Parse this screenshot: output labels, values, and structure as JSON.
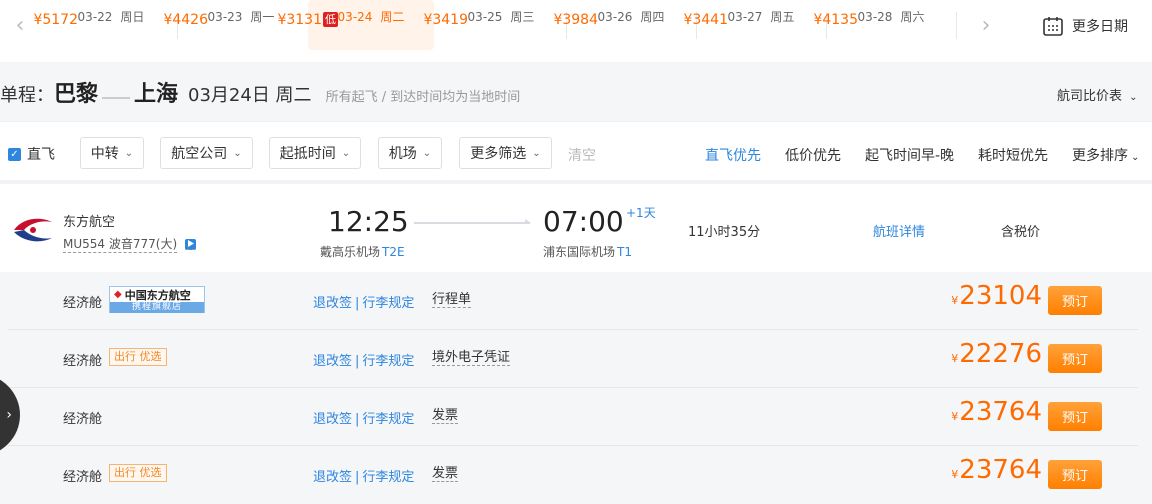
{
  "date_strip": {
    "dates": [
      {
        "date": "03-22",
        "weekday": "周日",
        "price": "¥5172"
      },
      {
        "date": "03-23",
        "weekday": "周一",
        "price": "¥4426"
      },
      {
        "date": "03-24",
        "weekday": "周二",
        "price": "¥3131",
        "badge": "低",
        "selected": true
      },
      {
        "date": "03-25",
        "weekday": "周三",
        "price": "¥3419"
      },
      {
        "date": "03-26",
        "weekday": "周四",
        "price": "¥3984"
      },
      {
        "date": "03-27",
        "weekday": "周五",
        "price": "¥3441"
      },
      {
        "date": "03-28",
        "weekday": "周六",
        "price": "¥4135"
      }
    ],
    "more_dates_label": "更多日期"
  },
  "trip": {
    "type_label": "单程：",
    "from_city": "巴黎",
    "to_city": "上海",
    "date_label": "03月24日 周二",
    "note": "所有起飞 / 到达时间均为当地时间",
    "compare_label": "航司比价表"
  },
  "filters": {
    "direct_label": "直飞",
    "direct_checked": true,
    "dropdowns": [
      "中转",
      "航空公司",
      "起抵时间",
      "机场",
      "更多筛选"
    ],
    "clear_label": "清空",
    "sorts": [
      "直飞优先",
      "低价优先",
      "起飞时间早-晚",
      "耗时短优先",
      "更多排序"
    ],
    "active_sort": "直飞优先"
  },
  "flight": {
    "airline": "东方航空",
    "flight_number": "MU554 波音777(大)",
    "dep_time": "12:25",
    "dep_airport": "戴高乐机场",
    "dep_terminal": "T2E",
    "arr_time": "07:00",
    "arr_airport": "浦东国际机场",
    "arr_terminal": "T1",
    "plus_day": "+1天",
    "duration": "11小时35分",
    "details_label": "航班详情",
    "tax_label": "含税价"
  },
  "fares": [
    {
      "cabin": "经济舱",
      "badge_type": "shop",
      "badge_line1": "中国东方航空",
      "badge_line2": "携程旗舰店",
      "rules_change": "退改签",
      "rules_sep": "|",
      "rules_baggage": "行李规定",
      "doc": "行程单",
      "currency": "¥",
      "price": "23104",
      "book_label": "预订"
    },
    {
      "cabin": "经济舱",
      "badge_type": "pref",
      "badge_text": "出行 优选",
      "rules_change": "退改签",
      "rules_sep": "|",
      "rules_baggage": "行李规定",
      "doc": "境外电子凭证",
      "currency": "¥",
      "price": "22276",
      "book_label": "预订"
    },
    {
      "cabin": "经济舱",
      "badge_type": "none",
      "rules_change": "退改签",
      "rules_sep": "|",
      "rules_baggage": "行李规定",
      "doc": "发票",
      "currency": "¥",
      "price": "23764",
      "book_label": "预订"
    },
    {
      "cabin": "经济舱",
      "badge_type": "pref",
      "badge_text": "出行 优选",
      "rules_change": "退改签",
      "rules_sep": "|",
      "rules_baggage": "行李规定",
      "doc": "发票",
      "currency": "¥",
      "price": "23764",
      "book_label": "预订"
    }
  ],
  "colors": {
    "accent_blue": "#2e86de",
    "price_orange": "#ff6a00",
    "low_badge_red": "#e02020",
    "book_button": "#ff8c1a"
  }
}
